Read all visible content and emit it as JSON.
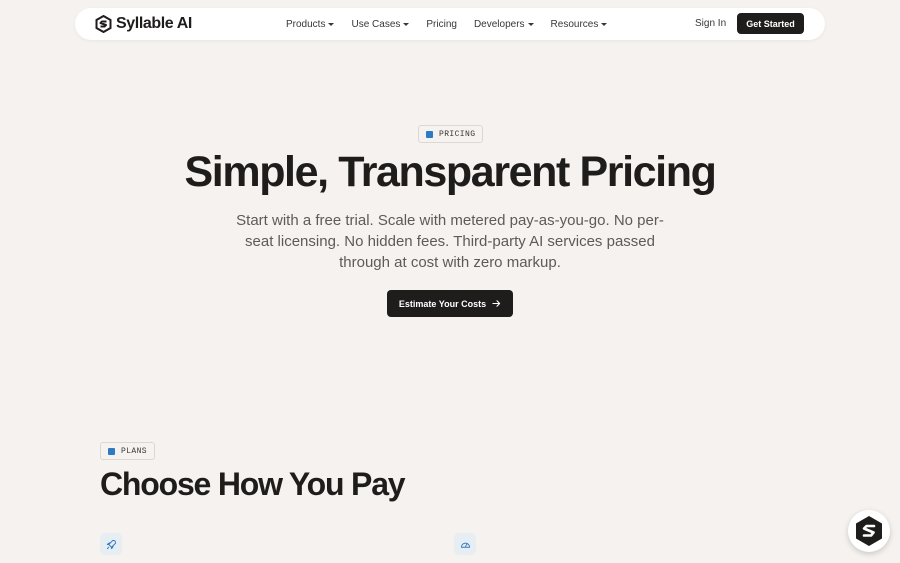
{
  "brand": {
    "name": "Syllable AI",
    "icon": "syllable-logo-icon"
  },
  "nav": {
    "items": [
      {
        "label": "Products",
        "has_dropdown": true
      },
      {
        "label": "Use Cases",
        "has_dropdown": true
      },
      {
        "label": "Pricing",
        "has_dropdown": false
      },
      {
        "label": "Developers",
        "has_dropdown": true
      },
      {
        "label": "Resources",
        "has_dropdown": true
      }
    ],
    "sign_in": "Sign In",
    "get_started": "Get Started"
  },
  "hero": {
    "tag": "PRICING",
    "title": "Simple, Transparent Pricing",
    "subtitle": "Start with a free trial. Scale with metered pay-as-you-go. No per-seat licensing. No hidden fees. Third-party AI services passed through at cost with zero markup.",
    "cta": "Estimate Your Costs"
  },
  "plans": {
    "tag": "PLANS",
    "title": "Choose How You Pay",
    "icons": [
      "rocket-icon",
      "gauge-icon"
    ]
  },
  "colors": {
    "background": "#f5f2ef",
    "dark": "#1f1c1c",
    "accent": "#2e7bc4",
    "icon_bg": "#e7eef3"
  }
}
